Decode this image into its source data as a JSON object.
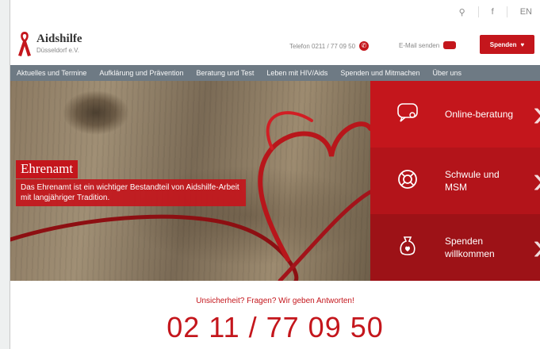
{
  "topbar": {
    "social_icons": [
      "search-icon",
      "facebook-icon",
      "flag-icon"
    ],
    "facebook": "f",
    "lang": "EN"
  },
  "logo": {
    "name": "Aidshilfe",
    "sub": "Düsseldorf e.V."
  },
  "header": {
    "phone": "Telefon 0211 / 77 09 50",
    "mail": "E-Mail senden",
    "donate": "Spenden"
  },
  "nav": {
    "items": [
      "Aktuelles und Termine",
      "Aufklärung und Prävention",
      "Beratung und Test",
      "Leben mit HIV/Aids",
      "Spenden und Mitmachen",
      "Über uns"
    ]
  },
  "hero": {
    "title": "Ehrenamt",
    "text": "Das Ehrenamt ist ein wichtiger Bestandteil von Aidshilfe-Arbeit mit langjähriger Tradition."
  },
  "tiles": [
    {
      "label": "Online-beratung",
      "icon": "chat-icon"
    },
    {
      "label": "Schwule und MSM",
      "icon": "lifebuoy-icon"
    },
    {
      "label": "Spenden willkommen",
      "icon": "donation-icon"
    }
  ],
  "contact": {
    "tagline": "Unsicherheit? Fragen? Wir geben Antworten!",
    "phone": "02 11 / 77 09 50"
  },
  "colors": {
    "accent": "#c4161c",
    "nav": "#6e7a84"
  }
}
